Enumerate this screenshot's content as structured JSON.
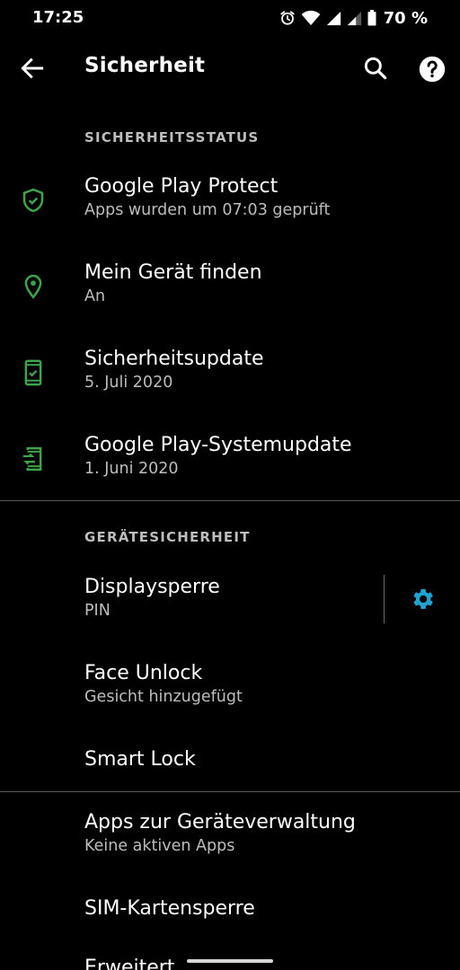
{
  "status_bar": {
    "time": "17:25",
    "battery": "70 %",
    "icons": [
      "alarm-icon",
      "wifi-icon",
      "signal-icon",
      "signal-icon-2",
      "battery-icon"
    ]
  },
  "app_bar": {
    "title": "Sicherheit",
    "back_icon": "arrow-back-icon",
    "search_icon": "search-icon",
    "help_icon": "help-icon"
  },
  "sections": {
    "security_status": {
      "header": "SICHERHEITSSTATUS",
      "items": [
        {
          "title": "Google Play Protect",
          "subtitle": "Apps wurden um 07:03 geprüft",
          "icon": "shield-check-icon"
        },
        {
          "title": "Mein Gerät finden",
          "subtitle": "An",
          "icon": "location-pin-icon"
        },
        {
          "title": "Sicherheitsupdate",
          "subtitle": "5. Juli 2020",
          "icon": "phone-check-icon"
        },
        {
          "title": "Google Play-Systemupdate",
          "subtitle": "1. Juni 2020",
          "icon": "phone-update-icon"
        }
      ]
    },
    "device_security": {
      "header": "GERÄTESICHERHEIT",
      "items": [
        {
          "title": "Displaysperre",
          "subtitle": "PIN",
          "icon": "gear-icon"
        },
        {
          "title": "Face Unlock",
          "subtitle": "Gesicht hinzugefügt"
        },
        {
          "title": "Smart Lock"
        }
      ]
    },
    "more": {
      "items": [
        {
          "title": "Apps zur Geräteverwaltung",
          "subtitle": "Keine aktiven Apps"
        },
        {
          "title": "SIM-Kartensperre"
        },
        {
          "title": "Erweitert"
        }
      ]
    }
  },
  "colors": {
    "background": "#000000",
    "icon_green": "#3ea34a",
    "accent_blue": "#1fa3d1",
    "secondary_text": "#bdbdbd"
  }
}
